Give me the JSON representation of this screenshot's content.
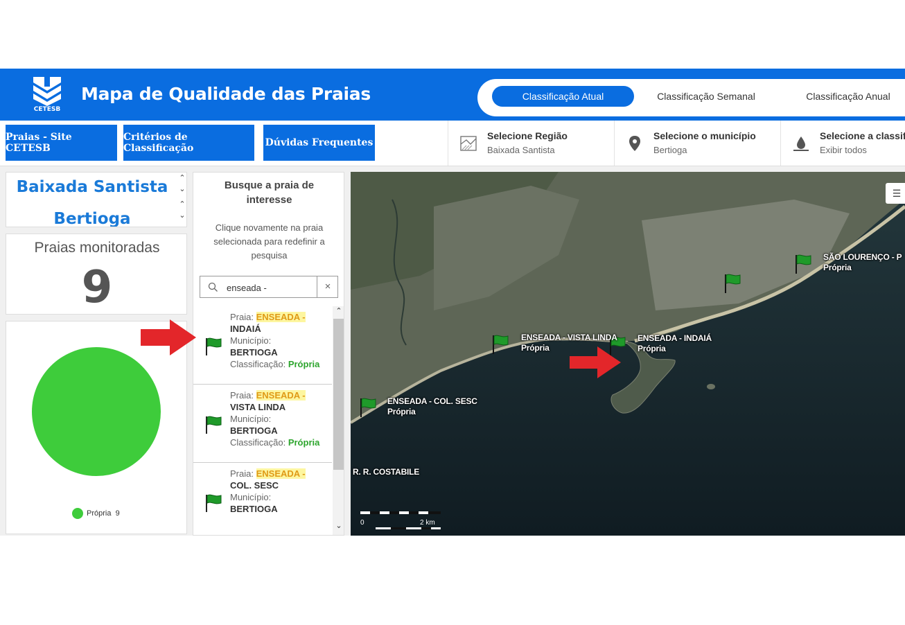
{
  "header": {
    "logo_text": "CETESB",
    "title": "Mapa de Qualidade das Praias",
    "tabs": [
      {
        "label": "Classificação Atual",
        "active": true
      },
      {
        "label": "Classificação Semanal",
        "active": false
      },
      {
        "label": "Classificação Anual",
        "active": false
      }
    ]
  },
  "toolbar": {
    "buttons": [
      "Praias - Site CETESB",
      "Critérios de Classificação",
      "Dúvidas Frequentes"
    ],
    "selectors": [
      {
        "title": "Selecione Região",
        "value": "Baixada Santista",
        "icon": "region-map-icon"
      },
      {
        "title": "Selecione o município",
        "value": "Bertioga",
        "icon": "location-pin-icon"
      },
      {
        "title": "Selecione a classifi",
        "value": "Exibir todos",
        "icon": "water-drop-icon"
      }
    ]
  },
  "region_panel": {
    "region": "Baixada Santista",
    "municipality": "Bertioga"
  },
  "monitored": {
    "label": "Praias monitoradas",
    "count": "9"
  },
  "pie": {
    "legend": [
      {
        "label": "Própria",
        "count": "9",
        "color": "#3ecc3b"
      }
    ]
  },
  "search": {
    "title": "Busque a praia de interesse",
    "hint": "Clique novamente na praia selecionada para redefinir a pesquisa",
    "query": "enseada -",
    "clear_icon": "×",
    "results": [
      {
        "praia_label": "Praia:",
        "name_hl": "ENSEADA -",
        "name_rest": "INDAIÁ",
        "mun_label": "Município:",
        "municipio": "BERTIOGA",
        "class_label": "Classificação:",
        "classificacao": "Própria"
      },
      {
        "praia_label": "Praia:",
        "name_hl": "ENSEADA -",
        "name_rest": "VISTA LINDA",
        "mun_label": "Município:",
        "municipio": "BERTIOGA",
        "class_label": "Classificação:",
        "classificacao": "Própria"
      },
      {
        "praia_label": "Praia:",
        "name_hl": "ENSEADA -",
        "name_rest": "COL. SESC",
        "mun_label": "Município:",
        "municipio": "BERTIOGA",
        "class_label": "",
        "classificacao": ""
      }
    ]
  },
  "map": {
    "labels": [
      {
        "name": "SÃO LOURENÇO - P",
        "status": "Própria"
      },
      {
        "name": "ENSEADA - VISTA LINDA",
        "status": "Própria"
      },
      {
        "name": "ENSEADA - INDAIÁ",
        "status": "Própria"
      },
      {
        "name": "ENSEADA - COL. SESC",
        "status": "Própria"
      },
      {
        "name": "R. R. COSTABILE",
        "status": ""
      }
    ],
    "scale": {
      "zero": "0",
      "distance": "2 km"
    },
    "layers_icon": "list-icon"
  },
  "colors": {
    "brand_blue": "#0a6de0",
    "propria_green": "#3ecc3b",
    "flag_green": "#1f9a2a",
    "arrow_red": "#e3262a"
  }
}
